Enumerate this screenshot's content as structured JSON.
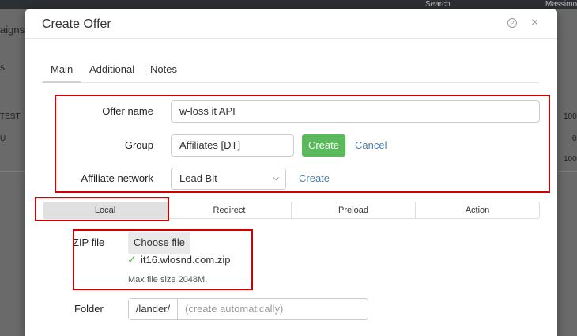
{
  "background": {
    "topbar": {
      "search": "Search",
      "user": "Massimo"
    },
    "left_texts": [
      "aigns",
      "s",
      "TEST",
      "U"
    ],
    "right_texts": [
      "100",
      "0",
      "100"
    ]
  },
  "modal": {
    "title": "Create Offer",
    "help_icon": "help-icon",
    "close_icon": "close-icon"
  },
  "tabs": [
    {
      "label": "Main",
      "active": true
    },
    {
      "label": "Additional",
      "active": false
    },
    {
      "label": "Notes",
      "active": false
    }
  ],
  "form": {
    "offer_name": {
      "label": "Offer name",
      "value": "w-loss it API"
    },
    "group": {
      "label": "Group",
      "value": "Affiliates [DT]",
      "create": "Create",
      "cancel": "Cancel"
    },
    "affiliate_network": {
      "label": "Affiliate network",
      "value": "Lead Bit",
      "create": "Create"
    }
  },
  "segment": [
    {
      "label": "Local",
      "active": true
    },
    {
      "label": "Redirect",
      "active": false
    },
    {
      "label": "Preload",
      "active": false
    },
    {
      "label": "Action",
      "active": false
    }
  ],
  "zip": {
    "label": "ZIP file",
    "button": "Choose file",
    "filename": "it16.wlosnd.com.zip",
    "hint": "Max file size 2048M."
  },
  "folder": {
    "label": "Folder",
    "prefix": "/lander/",
    "placeholder": "(create automatically)"
  },
  "colors": {
    "accent_green": "#5cb85c",
    "link_blue": "#4a7fb5",
    "highlight_red": "#d00000"
  }
}
